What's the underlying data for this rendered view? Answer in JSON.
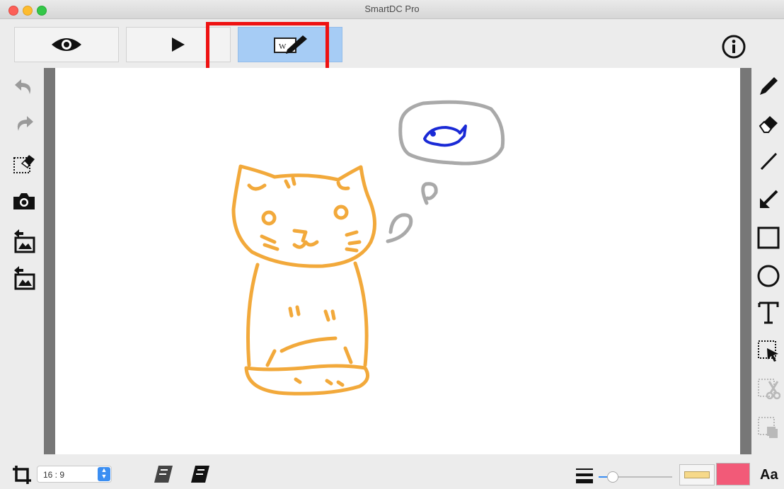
{
  "window": {
    "title": "SmartDC Pro"
  },
  "modes": [
    {
      "name": "view",
      "icon": "eye-icon"
    },
    {
      "name": "play",
      "icon": "play-icon"
    },
    {
      "name": "draw",
      "icon": "whiteboard-pen-icon",
      "active": true
    }
  ],
  "info_icon": "info-icon",
  "left_tools": [
    "undo-icon",
    "redo-icon",
    "clear-selection-icon",
    "camera-icon",
    "import-image-icon",
    "export-image-icon"
  ],
  "right_tools": [
    "pen-icon",
    "eraser-icon",
    "line-icon",
    "arrow-icon",
    "rectangle-icon",
    "ellipse-icon",
    "text-icon",
    "select-icon",
    "cut-icon",
    "copy-icon"
  ],
  "bottom": {
    "crop_icon": "crop-icon",
    "aspect_ratio": "16 : 9",
    "font_label": "Aa"
  },
  "colors": {
    "highlight": "#ee1111",
    "active_mode": "#a6ccf5",
    "drawing_cat": "#f2a93b",
    "drawing_bubble": "#a9a9a9",
    "drawing_fish": "#1a2ad6",
    "fill_swatch": "#f6d98a",
    "stroke_swatch": "#f25a78"
  }
}
